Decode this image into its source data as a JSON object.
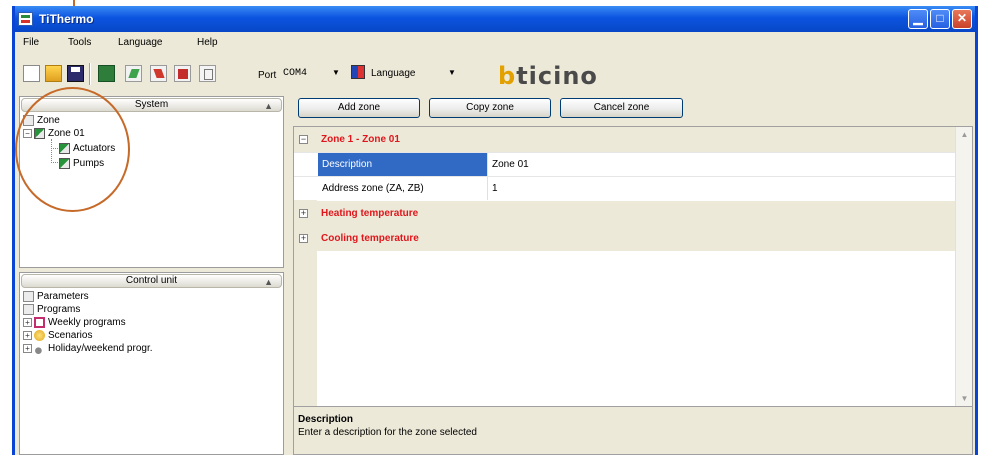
{
  "window": {
    "title": "TiThermo",
    "controls": {
      "minimize": "▁",
      "maximize": "□",
      "close": "✕"
    }
  },
  "menu": {
    "items": [
      "File",
      "Tools",
      "Language",
      "Help"
    ]
  },
  "toolbar": {
    "port_label": "Port",
    "port_value": "COM4",
    "language_label": "Language",
    "logo_text": "bticino",
    "icons": [
      "new-icon",
      "open-icon",
      "save-icon",
      "validate-icon",
      "send-icon",
      "receive-icon",
      "erase-icon",
      "document-icon",
      "language-flag-icon"
    ]
  },
  "system_panel": {
    "header": "System",
    "tree": {
      "root": "Zone",
      "zone": "Zone 01",
      "children": [
        "Actuators",
        "Pumps"
      ]
    }
  },
  "control_panel": {
    "header": "Control unit",
    "items": [
      "Parameters",
      "Programs",
      "Weekly programs",
      "Scenarios",
      "Holiday/weekend progr."
    ]
  },
  "actions": {
    "add": "Add zone",
    "copy": "Copy zone",
    "cancel": "Cancel zone"
  },
  "grid": {
    "zone_category": "Zone 1 - Zone 01",
    "properties": [
      {
        "name": "Description",
        "value": "Zone 01",
        "selected": true
      },
      {
        "name": "Address zone (ZA, ZB)",
        "value": "1",
        "selected": false
      }
    ],
    "heating": "Heating temperature",
    "cooling": "Cooling temperature",
    "expander_open": "−",
    "expander_closed": "+"
  },
  "description": {
    "title": "Description",
    "text": "Enter a description for the zone selected"
  },
  "colors": {
    "titlebar": "#0b54e0",
    "category_text": "#e0161c",
    "selection": "#316ac5",
    "annotation": "#c66a2a",
    "logo_accent": "#e2a100"
  }
}
